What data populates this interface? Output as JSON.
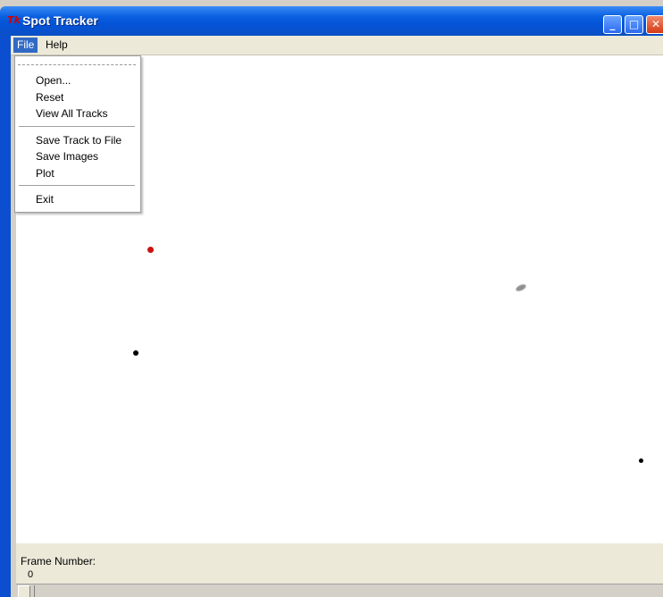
{
  "window": {
    "title": "Spot Tracker",
    "app_icon": "tk-feather-icon"
  },
  "menubar": {
    "file": "File",
    "help": "Help"
  },
  "file_menu": {
    "items": [
      "Open...",
      "Reset",
      "View All Tracks",
      "Save Track to File",
      "Save Images",
      "Plot",
      "Exit"
    ]
  },
  "bottom": {
    "frame_label": "Frame Number:",
    "frame_value": "0"
  },
  "colors": {
    "titlebar": "#0453d8",
    "menu_highlight": "#316ac5",
    "tracked_spot": "#cc1111",
    "spot": "#000000"
  }
}
